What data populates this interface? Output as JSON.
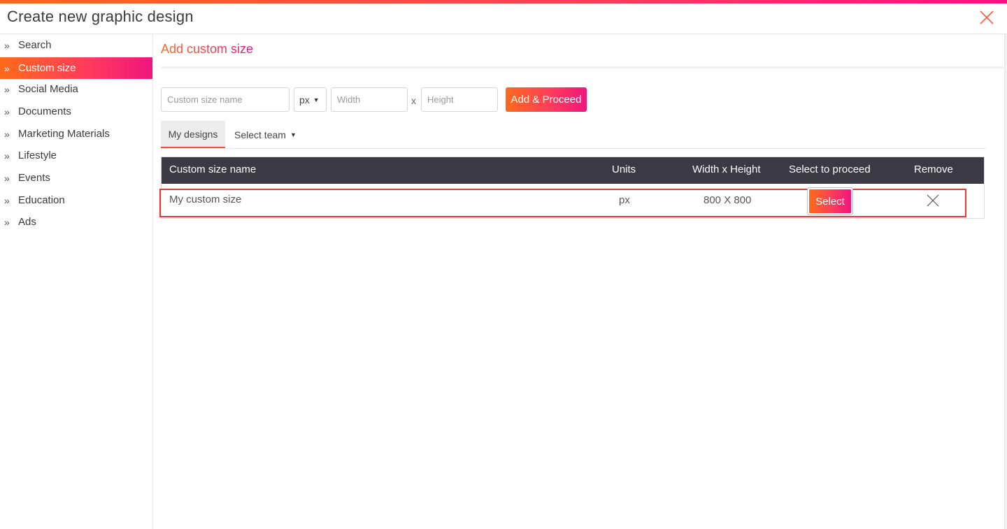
{
  "dialog": {
    "title": "Create new graphic design",
    "close_icon": "close-icon"
  },
  "sidebar": {
    "items": [
      {
        "label": "Search",
        "active": false
      },
      {
        "label": "Custom size",
        "active": true
      },
      {
        "label": "Social Media",
        "active": false
      },
      {
        "label": "Documents",
        "active": false
      },
      {
        "label": "Marketing Materials",
        "active": false
      },
      {
        "label": "Lifestyle",
        "active": false
      },
      {
        "label": "Events",
        "active": false
      },
      {
        "label": "Education",
        "active": false
      },
      {
        "label": "Ads",
        "active": false
      }
    ],
    "chevron": "»"
  },
  "main": {
    "section_title": "Add custom size",
    "form": {
      "name_placeholder": "Custom size name",
      "unit_value": "px",
      "width_placeholder": "Width",
      "times_symbol": "x",
      "height_placeholder": "Height",
      "add_button_label": "Add & Proceed"
    },
    "tabs": [
      {
        "label": "My designs",
        "active": true
      },
      {
        "label": "Select team",
        "active": false,
        "dropdown": true
      }
    ],
    "table": {
      "headers": [
        "Custom size name",
        "Units",
        "Width x Height",
        "Select to proceed",
        "Remove"
      ],
      "rows": [
        {
          "name": "My custom size",
          "units": "px",
          "dimensions": "800 X 800",
          "select_label": "Select",
          "remove_icon": "close-icon"
        }
      ]
    }
  },
  "colors": {
    "accent_start": "#ff6a1a",
    "accent_end": "#f0157e",
    "table_header_bg": "#3a3944",
    "highlight_border": "#e53935"
  }
}
